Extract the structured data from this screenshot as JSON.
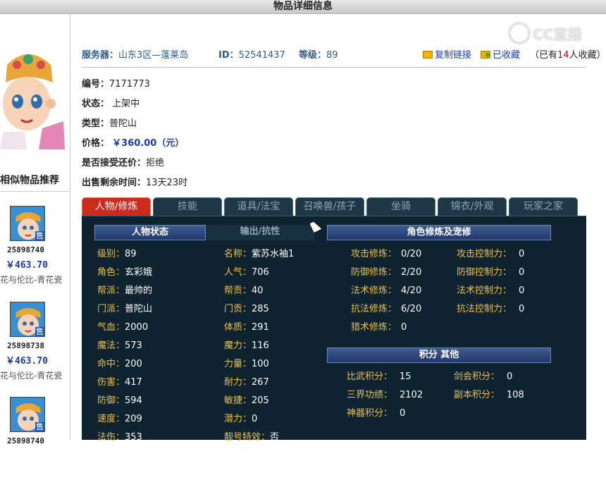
{
  "window": {
    "title": "物品详细信息"
  },
  "watermark": {
    "text": "CC直播"
  },
  "server": {
    "label": "服务器：",
    "value": "山东3区—蓬莱岛"
  },
  "id": {
    "label": "ID：",
    "value": "52541437"
  },
  "level": {
    "label": "等级：",
    "value": "89"
  },
  "actions": {
    "copy_link": "复制链接",
    "favorited": "已收藏",
    "fav_prefix": "（已有",
    "fav_count": "14",
    "fav_suffix": "人收藏）"
  },
  "details": {
    "number_label": "编号：",
    "number": "7171773",
    "status_label": "状态：",
    "status": "上架中",
    "type_label": "类型：",
    "type": "普陀山",
    "price_label": "价格：",
    "price": "￥360.00（元）",
    "bargain_label": "是否接受还价：",
    "bargain": "拒绝",
    "remaining_label": "出售剩余时间：",
    "remaining": "13天23时"
  },
  "similar": {
    "title": "相似物品推荐",
    "items": [
      {
        "id": "25898740",
        "price": "￥463.70",
        "server": "花与伦比-青花瓷",
        "sold": "售"
      },
      {
        "id": "25898738",
        "price": "￥463.70",
        "server": "花与伦比-青花瓷",
        "sold": "售"
      },
      {
        "id": "25898740",
        "price": "",
        "server": "",
        "sold": "售"
      }
    ]
  },
  "tabs": [
    "人物/修炼",
    "技能",
    "道具/法宝",
    "召唤兽/孩子",
    "坐骑",
    "锦衣/外观",
    "玩家之家"
  ],
  "panel": {
    "char_header": "人物状态",
    "output_header": "输出/抗性",
    "cult_header": "角色修炼及宠修",
    "score_header": "积分 其他",
    "left_stats": [
      {
        "k": "级别：",
        "v": "89"
      },
      {
        "k": "角色：",
        "v": "玄彩娥"
      },
      {
        "k": "帮派：",
        "v": "最帅的"
      },
      {
        "k": "门派：",
        "v": "普陀山"
      },
      {
        "k": "气血：",
        "v": "2000"
      },
      {
        "k": "魔法：",
        "v": "573"
      },
      {
        "k": "命中：",
        "v": "200"
      },
      {
        "k": "伤害：",
        "v": "417"
      },
      {
        "k": "防御：",
        "v": "594"
      },
      {
        "k": "速度：",
        "v": "209"
      },
      {
        "k": "法伤：",
        "v": "353"
      }
    ],
    "mid_stats": [
      {
        "k": "名称：",
        "v": "紫苏水袖1"
      },
      {
        "k": "人气：",
        "v": "706"
      },
      {
        "k": "帮贡：",
        "v": "40"
      },
      {
        "k": "门贡：",
        "v": "285"
      },
      {
        "k": "体质：",
        "v": "291"
      },
      {
        "k": "魔力：",
        "v": "116"
      },
      {
        "k": "力量：",
        "v": "100"
      },
      {
        "k": "耐力：",
        "v": "267"
      },
      {
        "k": "敏捷：",
        "v": "205"
      },
      {
        "k": "潜力：",
        "v": "0"
      },
      {
        "k": "靓号特效：",
        "v": "否"
      }
    ],
    "cult_left": [
      {
        "k": "攻击修炼：",
        "v": "0/20"
      },
      {
        "k": "防御修炼：",
        "v": "2/20"
      },
      {
        "k": "法术修炼：",
        "v": "4/20"
      },
      {
        "k": "抗法修炼：",
        "v": "6/20"
      },
      {
        "k": "猎术修炼：",
        "v": "0"
      }
    ],
    "cult_right": [
      {
        "k": "攻击控制力：",
        "v": "0"
      },
      {
        "k": "防御控制力：",
        "v": "0"
      },
      {
        "k": "法术控制力：",
        "v": "0"
      },
      {
        "k": "抗法控制力：",
        "v": "0"
      }
    ],
    "score_left": [
      {
        "k": "比武积分：",
        "v": "15"
      },
      {
        "k": "三界功绩：",
        "v": "2102"
      },
      {
        "k": "神器积分：",
        "v": "0"
      }
    ],
    "score_right": [
      {
        "k": "剑会积分：",
        "v": "0"
      },
      {
        "k": "副本积分：",
        "v": "108"
      }
    ]
  }
}
